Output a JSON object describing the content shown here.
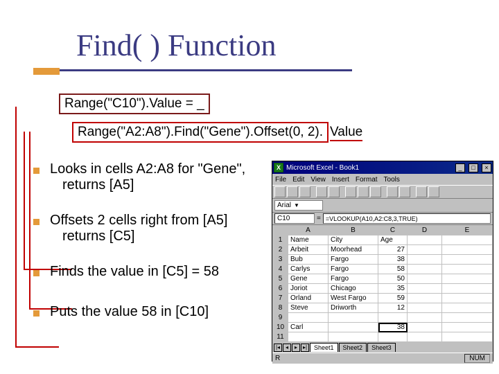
{
  "title": "Find( ) Function",
  "code": {
    "line1_text": "Range(\"C10\").Value = _",
    "line2_part1": "Range(\"A2:A8\").",
    "line2_part2": "Find(\"Gene\").",
    "line2_part3": "Offset(0, 2).",
    "line2_part4": "Value"
  },
  "bullets": {
    "b1_l1": "Looks in cells A2:A8 for \"Gene\",",
    "b1_l2": "returns [A5]",
    "b2_l1": "Offsets 2 cells right from [A5]",
    "b2_l2": "returns [C5]",
    "b3": "Finds the value in [C5] = 58",
    "b4": "Puts the value 58 in [C10]"
  },
  "excel": {
    "app_title": "Microsoft Excel - Book1",
    "menus": [
      "File",
      "Edit",
      "View",
      "Insert",
      "Format",
      "Tools"
    ],
    "font_name": "Arial",
    "name_box": "C10",
    "formula": "=VLOOKUP(A10,A2:C8,3,TRUE)",
    "col_headers": [
      "A",
      "B",
      "C",
      "D",
      "E"
    ],
    "rows": [
      {
        "n": "1",
        "A": "Name",
        "B": "City",
        "C": "Age",
        "D": "",
        "E": ""
      },
      {
        "n": "2",
        "A": "Arbeit",
        "B": "Moorhead",
        "C": "27",
        "D": "",
        "E": ""
      },
      {
        "n": "3",
        "A": "Bub",
        "B": "Fargo",
        "C": "38",
        "D": "",
        "E": ""
      },
      {
        "n": "4",
        "A": "Carlys",
        "B": "Fargo",
        "C": "58",
        "D": "",
        "E": ""
      },
      {
        "n": "5",
        "A": "Gene",
        "B": "Fargo",
        "C": "50",
        "D": "",
        "E": ""
      },
      {
        "n": "6",
        "A": "Joriot",
        "B": "Chicago",
        "C": "35",
        "D": "",
        "E": ""
      },
      {
        "n": "7",
        "A": "Orland",
        "B": "West Fargo",
        "C": "59",
        "D": "",
        "E": ""
      },
      {
        "n": "8",
        "A": "Steve",
        "B": "Driworth",
        "C": "12",
        "D": "",
        "E": ""
      },
      {
        "n": "9",
        "A": "",
        "B": "",
        "C": "",
        "D": "",
        "E": ""
      },
      {
        "n": "10",
        "A": "Carl",
        "B": "",
        "C": "38",
        "D": "",
        "E": ""
      },
      {
        "n": "11",
        "A": "",
        "B": "",
        "C": "",
        "D": "",
        "E": ""
      }
    ],
    "sheet_tabs": [
      "Sheet1",
      "Sheet2",
      "Sheet3"
    ],
    "status_left": "R",
    "status_right": "NUM"
  }
}
